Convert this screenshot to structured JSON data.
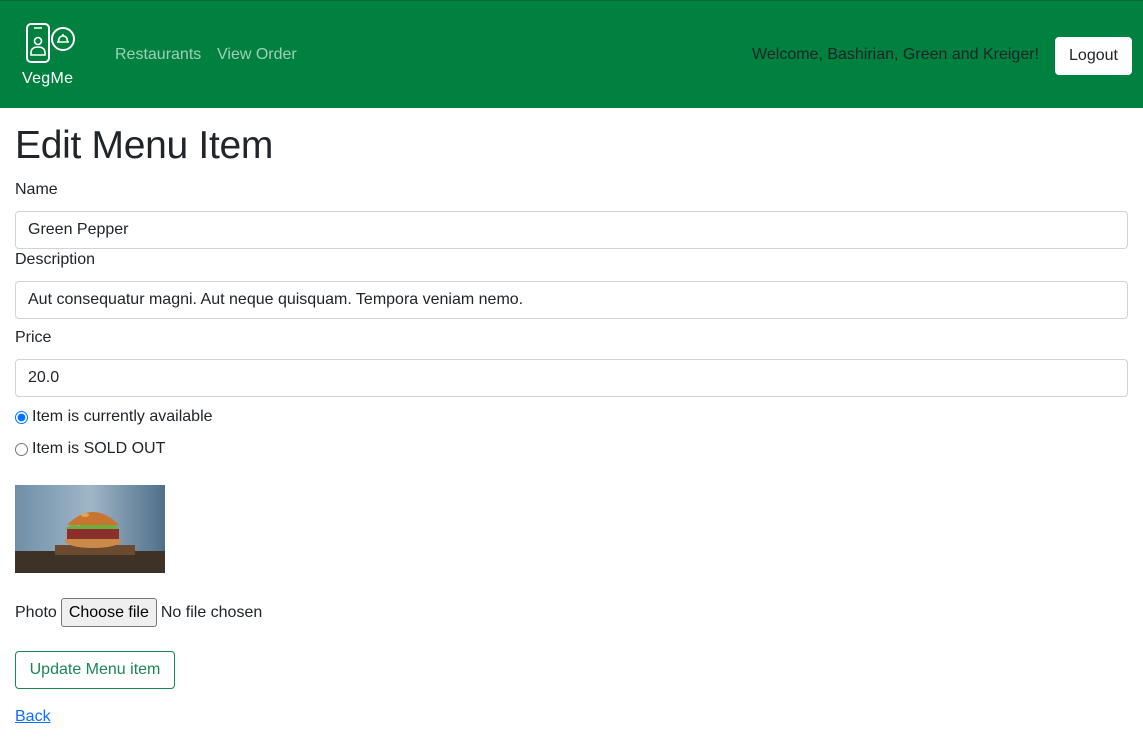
{
  "nav": {
    "brand": "VegMe",
    "links": [
      "Restaurants",
      "View Order"
    ],
    "welcome": "Welcome, Bashirian, Green and Kreiger!",
    "logout": "Logout"
  },
  "page": {
    "title": "Edit Menu Item"
  },
  "form": {
    "name_label": "Name",
    "name_value": "Green Pepper",
    "description_label": "Description",
    "description_value": "Aut consequatur magni. Aut neque quisquam. Tempora veniam nemo.",
    "price_label": "Price",
    "price_value": "20.0",
    "available_label": "Item is currently available",
    "soldout_label": "Item is SOLD OUT",
    "available_selected": true,
    "photo_label": "Photo",
    "choose_file": "Choose file",
    "file_status": "No file chosen",
    "submit": "Update Menu item",
    "back": "Back"
  },
  "colors": {
    "navbar": "#00813f",
    "accent_green": "#198754",
    "link": "#0d6efd"
  },
  "icons": {
    "brand": "phone-food-cloche-icon"
  }
}
